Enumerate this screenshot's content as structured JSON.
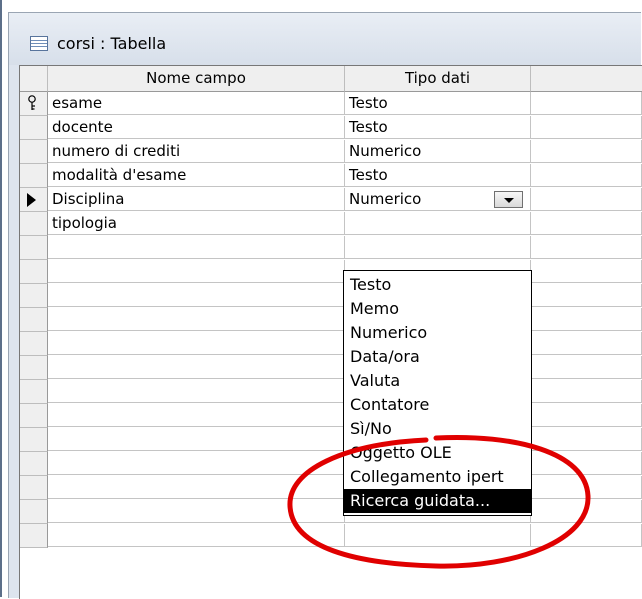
{
  "window": {
    "title": "corsi : Tabella",
    "title_icon": "table-icon"
  },
  "grid": {
    "columns": [
      "Nome campo",
      "Tipo dati"
    ],
    "rows": [
      {
        "field": "esame",
        "type": "Testo",
        "selector": "primary-key-icon"
      },
      {
        "field": "docente",
        "type": "Testo",
        "selector": ""
      },
      {
        "field": "numero di crediti",
        "type": "Numerico",
        "selector": ""
      },
      {
        "field": "modalità d'esame",
        "type": "Testo",
        "selector": ""
      },
      {
        "field": "Disciplina",
        "type": "Numerico",
        "selector": "current-row-arrow-icon"
      },
      {
        "field": "tipologia",
        "type": "",
        "selector": ""
      }
    ],
    "empty_rows": 13
  },
  "dropdown": {
    "items": [
      "Testo",
      "Memo",
      "Numerico",
      "Data/ora",
      "Valuta",
      "Contatore",
      "Sì/No",
      "Oggetto OLE",
      "Collegamento ipert",
      "Ricerca guidata..."
    ],
    "highlighted": "Ricerca guidata..."
  },
  "annotation": {
    "shape": "ellipse",
    "color": "#e00000"
  }
}
